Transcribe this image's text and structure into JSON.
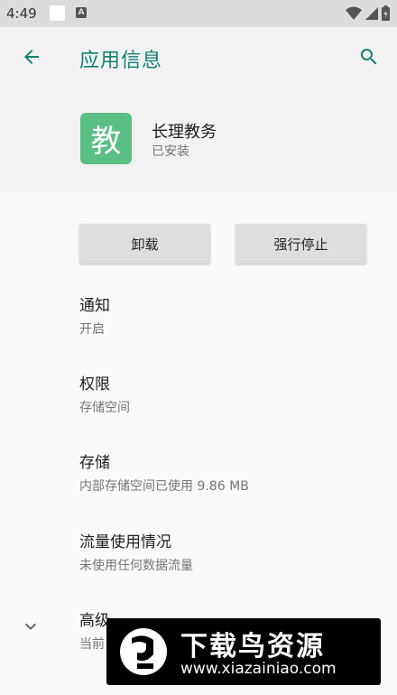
{
  "status_bar": {
    "time": "4:49",
    "icons": [
      "notification-square-icon",
      "a-icon",
      "wifi-icon",
      "signal-icon",
      "battery-icon"
    ]
  },
  "toolbar": {
    "title": "应用信息",
    "back_icon": "arrow-left-icon",
    "search_icon": "search-icon"
  },
  "app": {
    "icon_char": "教",
    "name": "长理教务",
    "status": "已安装",
    "icon_color": "#5abf82"
  },
  "actions": {
    "uninstall": "卸载",
    "force_stop": "强行停止"
  },
  "prefs": [
    {
      "title": "通知",
      "summary": "开启"
    },
    {
      "title": "权限",
      "summary": "存储空间"
    },
    {
      "title": "存储",
      "summary": "内部存储空间已使用 9.86 MB"
    },
    {
      "title": "流量使用情况",
      "summary": "未使用任何数据流量"
    },
    {
      "title": "高级",
      "summary": "当前"
    }
  ],
  "watermark": {
    "title": "下载鸟资源",
    "url": "www.xiazainiao.com"
  },
  "colors": {
    "accent": "#11806f",
    "status_bar": "#dcdcdc",
    "background": "#fafafa"
  }
}
